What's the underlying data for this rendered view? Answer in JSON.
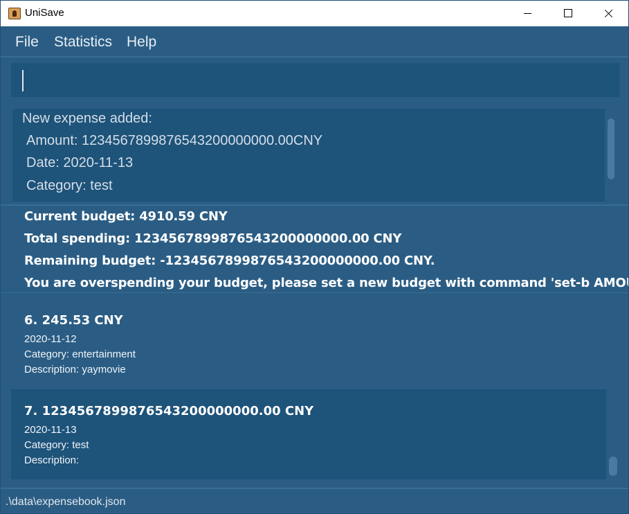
{
  "window": {
    "title": "UniSave"
  },
  "menu": {
    "items": [
      {
        "label": "File"
      },
      {
        "label": "Statistics"
      },
      {
        "label": "Help"
      }
    ]
  },
  "command_box": {
    "value": ""
  },
  "result": {
    "lines": [
      "New expense added:",
      "Amount: 1234567899876543200000000.00CNY",
      "Date: 2020-11-13",
      "Category: test"
    ]
  },
  "budget": {
    "current": "Current budget: 4910.59 CNY",
    "total_spending": "Total spending: 1234567899876543200000000.00 CNY",
    "remaining": "Remaining budget: -1234567899876543200000000.00 CNY.",
    "warning": "You are overspending your budget, please set a new budget with command 'set-b AMOUNT'."
  },
  "expenses": [
    {
      "title": "6.  245.53 CNY",
      "date": "2020-11-12",
      "category": "Category: entertainment",
      "description": "Description: yaymovie"
    },
    {
      "title": "7.  1234567899876543200000000.00 CNY",
      "date": "2020-11-13",
      "category": "Category: test",
      "description": "Description:"
    }
  ],
  "status": {
    "path": ".\\data\\expensebook.json"
  },
  "colors": {
    "background": "#2b5d84",
    "panel": "#1e537a",
    "text": "#ffffff"
  }
}
